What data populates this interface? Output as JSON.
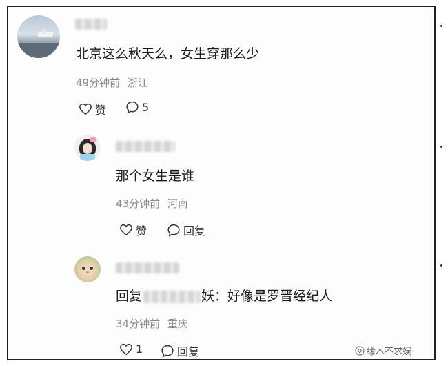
{
  "comment1": {
    "text": "北京这么秋天么，女生穿那么少",
    "time": "49分钟前",
    "location": "浙江",
    "like_label": "赞",
    "reply_count": "5"
  },
  "reply1": {
    "text": "那个女生是谁",
    "time": "43分钟前",
    "location": "河南",
    "like_label": "赞",
    "reply_label": "回复"
  },
  "reply2": {
    "prefix": "回复",
    "suffix": "妖：好像是罗晋经纪人",
    "time": "34分钟前",
    "location": "重庆",
    "like_count": "1",
    "reply_label": "回复"
  },
  "watermark": {
    "text": "缘木不求娱"
  }
}
